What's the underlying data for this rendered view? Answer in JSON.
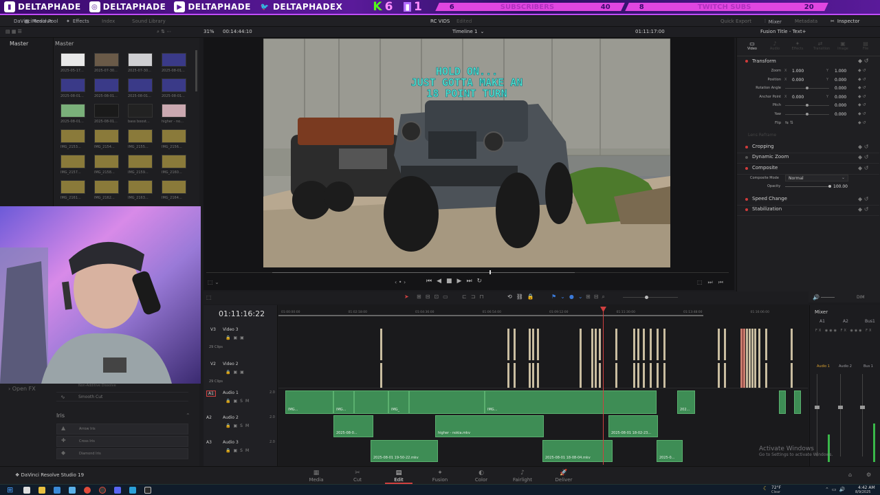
{
  "banner": {
    "handles": [
      {
        "icon": "instagram-icon",
        "name": "DELTAPHADE"
      },
      {
        "icon": "youtube-icon",
        "name": "DELTAPHADE"
      },
      {
        "icon": "twitter-icon",
        "name": "DELTAPHADEX"
      }
    ],
    "twitch_icon_handle": "DELTAPHADE",
    "kick_count": "6",
    "twitch_count": "1",
    "stats": [
      {
        "current": "6",
        "label": "SUBSCRIBERS",
        "goal": "40"
      },
      {
        "current": "8",
        "label": "TWITCH SUBS",
        "goal": "20"
      }
    ]
  },
  "topbar": {
    "app_name": "DaVinci Resolve",
    "left_tabs": [
      "Media Pool",
      "Effects",
      "Index",
      "Sound Library"
    ],
    "project": "RC VIDS",
    "project_state": "Edited",
    "right_tabs": [
      "Quick Export",
      "Mixer",
      "Metadata",
      "Inspector"
    ]
  },
  "viewer_bar": {
    "zoom": "31%",
    "timecode": "00:14:44:10",
    "timeline_name": "Timeline 1",
    "record_tc": "01:11:17:00",
    "inspector_title": "Fusion Title - Text+"
  },
  "media_pool": {
    "bins": [
      "Master",
      "Master"
    ],
    "clips": [
      "2025-05-17...",
      "2025-07-30...",
      "2025-07-30...",
      "2025-08-01...",
      "2025-08-01...",
      "2025-08-01...",
      "2025-08-01...",
      "2025-08-01...",
      "2025-08-01...",
      "2025-08-01...",
      "bass boost...",
      "higher - no...",
      "IMG_2153...",
      "IMG_2154...",
      "IMG_2155...",
      "IMG_2156...",
      "IMG_2157...",
      "IMG_2158...",
      "IMG_2159...",
      "IMG_2160...",
      "IMG_2161...",
      "IMG_2162...",
      "IMG_2163...",
      "IMG_2164..."
    ]
  },
  "effects": {
    "open_fx": "Open FX",
    "transitions": [
      "Non-Additive Dissolve",
      "Smooth Cut"
    ],
    "iris_title": "Iris",
    "iris_items": [
      "Arrow Iris",
      "Cross Iris",
      "Diamond Iris"
    ]
  },
  "title_overlay": [
    "HOLD ON...",
    "JUST GOTTA MAKE AN",
    "18 POINT TURN"
  ],
  "inspector": {
    "tabs": [
      "Video",
      "Audio",
      "Effects",
      "Transition",
      "Image",
      "File"
    ],
    "transform_title": "Transform",
    "rows": [
      {
        "label": "Zoom",
        "x": "1.000",
        "y": "1.000"
      },
      {
        "label": "Position",
        "x": "0.000",
        "y": "0.000"
      },
      {
        "label": "Rotation Angle",
        "v": "0.000"
      },
      {
        "label": "Anchor Point",
        "x": "0.000",
        "y": "0.000"
      },
      {
        "label": "Pitch",
        "v": "0.000"
      },
      {
        "label": "Yaw",
        "v": "0.000"
      },
      {
        "label": "Flip",
        "v": ""
      }
    ],
    "lens": "Lens Reframe",
    "sections": [
      "Cropping",
      "Dynamic Zoom",
      "Composite",
      "Speed Change",
      "Stabilization"
    ],
    "composite_mode_label": "Composite Mode",
    "composite_mode": "Normal",
    "opacity_label": "Opacity",
    "opacity": "100.00"
  },
  "timeline": {
    "timecode": "01:11:16:22",
    "ruler": [
      "01:00:00:00",
      "01:02:18:00",
      "01:04:36:00",
      "01:06:54:00",
      "01:09:12:00",
      "01:11:30:00",
      "01:13:48:00",
      "01:16:06:00"
    ],
    "tracks": [
      {
        "id": "V3",
        "name": "Video 3",
        "clips": "29 Clips"
      },
      {
        "id": "V2",
        "name": "Video 2",
        "clips": "29 Clips"
      },
      {
        "id": "A1",
        "name": "Audio 1",
        "level": "2.0"
      },
      {
        "id": "A2",
        "name": "Audio 2",
        "level": "2.0"
      },
      {
        "id": "A3",
        "name": "Audio 3",
        "level": "2.0"
      }
    ],
    "audio_clips": [
      "IMG...",
      "IMG...",
      "IMG_",
      "IMG...",
      "202...",
      "2025-08-0...",
      "higher - nokia.mkv",
      "2025-08-01 18-02-23...",
      "2025-08-01 19-50-22.mkv",
      "2025-08-01 18-08-04.mkv",
      "2025-0..."
    ],
    "dim": "DIM"
  },
  "mixer": {
    "title": "Mixer",
    "channels": [
      "A1",
      "A2",
      "Bus1"
    ],
    "bottom": [
      "Audio 1",
      "Audio 2",
      "Bus 1"
    ]
  },
  "pages": [
    "Media",
    "Cut",
    "Edit",
    "Fusion",
    "Color",
    "Fairlight",
    "Deliver"
  ],
  "app_label": "DaVinci Resolve Studio 19",
  "watermark": {
    "line1": "Activate Windows",
    "line2": "Go to Settings to activate Windows."
  },
  "taskbar": {
    "temp": "72°F",
    "weather": "Clear",
    "time": "4:42 AM",
    "date": "8/9/2025"
  }
}
